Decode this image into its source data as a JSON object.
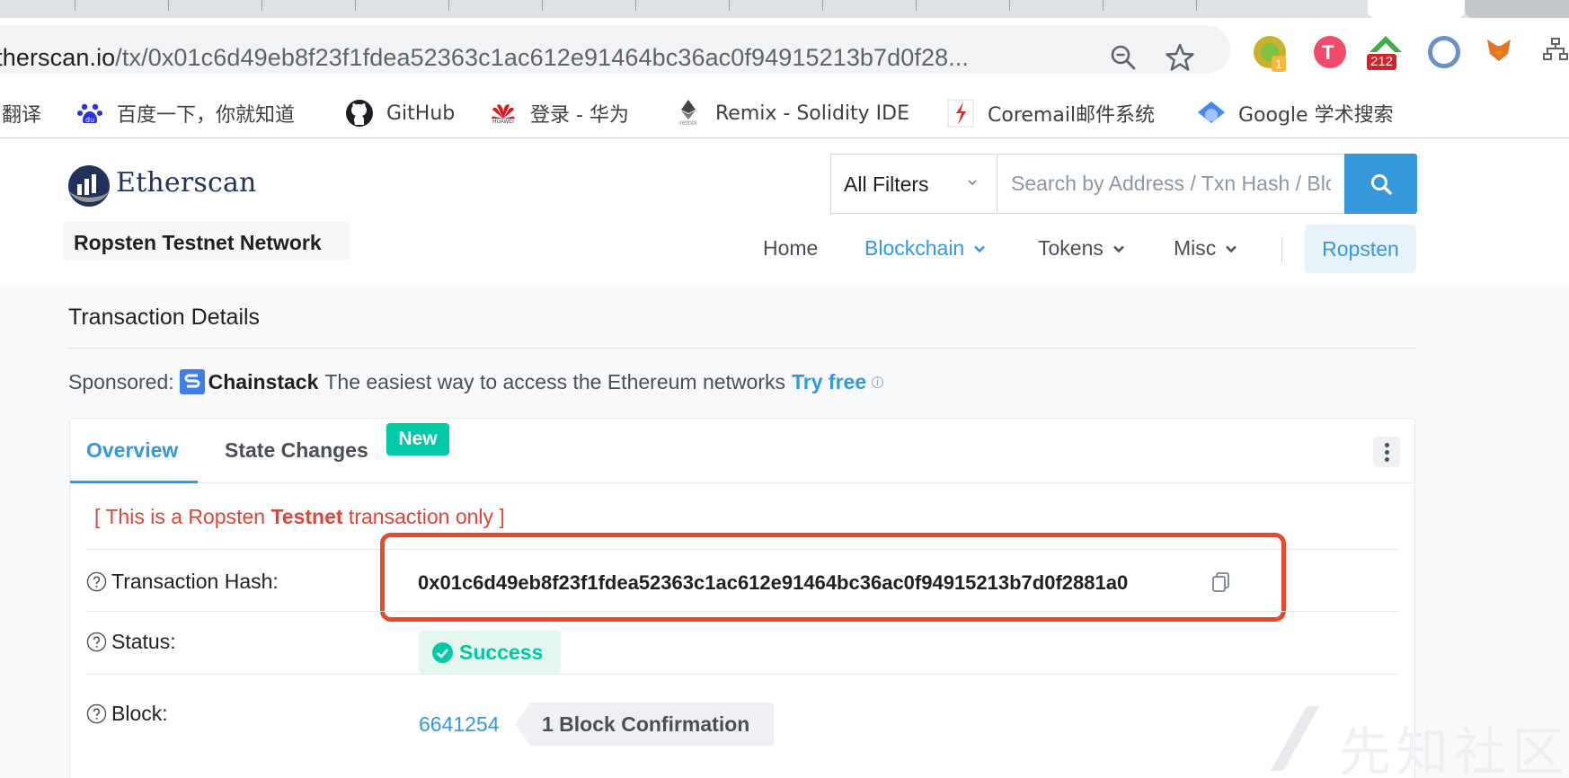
{
  "browser": {
    "url_host": "etherscan.io",
    "url_path": "/tx/0x01c6d49eb8f23f1fdea52363c1ac612e91464bc36ac0f94915213b7d0f28...",
    "extensions": [
      {
        "name": "ext-green-circle",
        "badge": "1"
      },
      {
        "name": "ext-pink-t",
        "badge": ""
      },
      {
        "name": "ext-green-arrow",
        "badge": "212"
      },
      {
        "name": "ext-blue-ring",
        "badge": ""
      },
      {
        "name": "ext-metamask-fox",
        "badge": ""
      },
      {
        "name": "ext-sitemap",
        "badge": ""
      }
    ],
    "bookmarks": [
      {
        "label": "翻译",
        "icon": "translate-icon"
      },
      {
        "label": "百度一下，你就知道",
        "icon": "baidu-icon"
      },
      {
        "label": "GitHub",
        "icon": "github-icon"
      },
      {
        "label": "登录 - 华为",
        "icon": "huawei-icon"
      },
      {
        "label": "Remix - Solidity IDE",
        "icon": "remix-icon"
      },
      {
        "label": "Coremail邮件系统",
        "icon": "coremail-icon"
      },
      {
        "label": "Google 学术搜索",
        "icon": "google-scholar-icon"
      }
    ],
    "remix_sublabel": "remix",
    "huawei_sublabel": "HUAWEI"
  },
  "header": {
    "logo_text": "Etherscan",
    "network": "Ropsten Testnet Network",
    "filter_label": "All Filters",
    "search_placeholder": "Search by Address / Txn Hash / Block / Token / Ens",
    "nav": {
      "home": "Home",
      "blockchain": "Blockchain",
      "tokens": "Tokens",
      "misc": "Misc",
      "network_button": "Ropsten"
    }
  },
  "page": {
    "title": "Transaction Details",
    "sponsored": {
      "prefix": "Sponsored:",
      "brand": "Chainstack",
      "text": "The easiest way to access the Ethereum networks",
      "link": "Try free",
      "info": "i"
    },
    "tabs": {
      "overview": "Overview",
      "state_changes": "State Changes",
      "new_badge": "New"
    },
    "testnet_note": {
      "open": "[ This is a Ropsten ",
      "bold": "Testnet",
      "close": " transaction only ]"
    },
    "rows": {
      "hash_label": "Transaction Hash:",
      "hash_value": "0x01c6d49eb8f23f1fdea52363c1ac612e91464bc36ac0f94915213b7d0f2881a0",
      "status_label": "Status:",
      "status_value": "Success",
      "block_label": "Block:",
      "block_value": "6641254",
      "block_confirmations": "1 Block Confirmation"
    }
  },
  "watermark": "先知社区",
  "colors": {
    "accent": "#3498db",
    "success": "#00c9a7",
    "danger": "#de4437",
    "highlight": "#e8482c"
  }
}
